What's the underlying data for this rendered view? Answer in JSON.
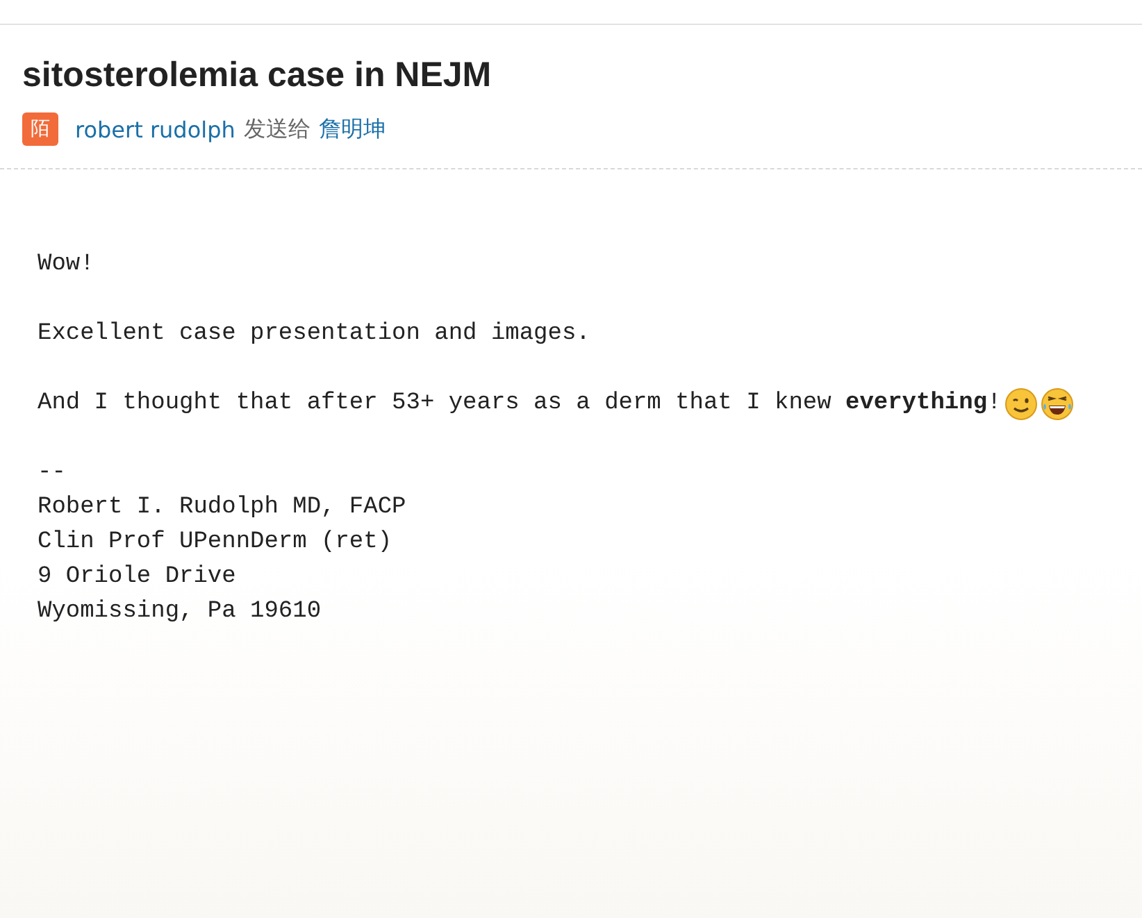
{
  "message": {
    "subject": "sitosterolemia case in NEJM",
    "sender_badge": "陌",
    "sender": "robert rudolph",
    "sent_to_label": "发送给",
    "recipient": "詹明坤"
  },
  "body": {
    "paragraphs": [
      "Wow!",
      "Excellent case presentation and images.",
      "And I thought that after 53+ years as a derm that I knew **everything**!"
    ],
    "signature_separator": "--",
    "signature": [
      "Robert I. Rudolph MD, FACP",
      "Clin Prof UPennDerm (ret)",
      "9 Oriole Drive",
      "Wyomissing, Pa 19610"
    ]
  }
}
